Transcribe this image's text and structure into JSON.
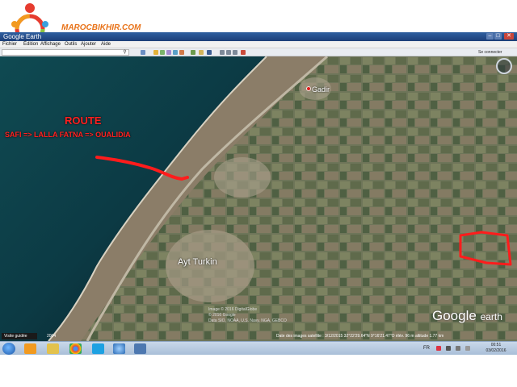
{
  "watermark": {
    "text": "MAROCBIKHIR.COM"
  },
  "window": {
    "title": "Google Earth",
    "min_label": "–",
    "max_label": "□",
    "close_label": "✕"
  },
  "menu": {
    "items": [
      {
        "label": "Fichier"
      },
      {
        "label": "Édition"
      },
      {
        "label": "Affichage"
      },
      {
        "label": "Outils"
      },
      {
        "label": "Ajouter"
      },
      {
        "label": "Aide"
      }
    ]
  },
  "toolbar": {
    "search_placeholder": "",
    "connect_label": "Se connecter"
  },
  "map": {
    "route_title": "ROUTE",
    "route_path": "SAFI => LALLA FATNA => OUALIDIA",
    "place_gadir": "Gadir",
    "place_ayt": "Ayt Turkin",
    "copyright_line1": "Image © 2016 DigitalGlobe",
    "copyright_line2": "© 2016 Google",
    "copyright_line3": "Data SIO, NOAA, U.S. Navy, NGA, GEBCO",
    "logo_word1": "Google",
    "logo_word2": "earth",
    "pano_label": "Visite guidée",
    "year_label": "2004",
    "status": "Date des images satellite : 3/12/2015    32°22'29.64\"N    9°16'21.47\"O  élév.   96 m     altitude   1.77 km",
    "accent_color": "#ff2020"
  },
  "taskbar": {
    "lang": "FR",
    "clock_time": "00:51",
    "clock_date": "03/02/2016",
    "apps": [
      {
        "icon": "media-player-icon"
      },
      {
        "icon": "explorer-icon"
      },
      {
        "icon": "chrome-icon"
      },
      {
        "icon": "skype-icon"
      },
      {
        "icon": "google-earth-icon"
      },
      {
        "icon": "window-icon"
      }
    ]
  }
}
